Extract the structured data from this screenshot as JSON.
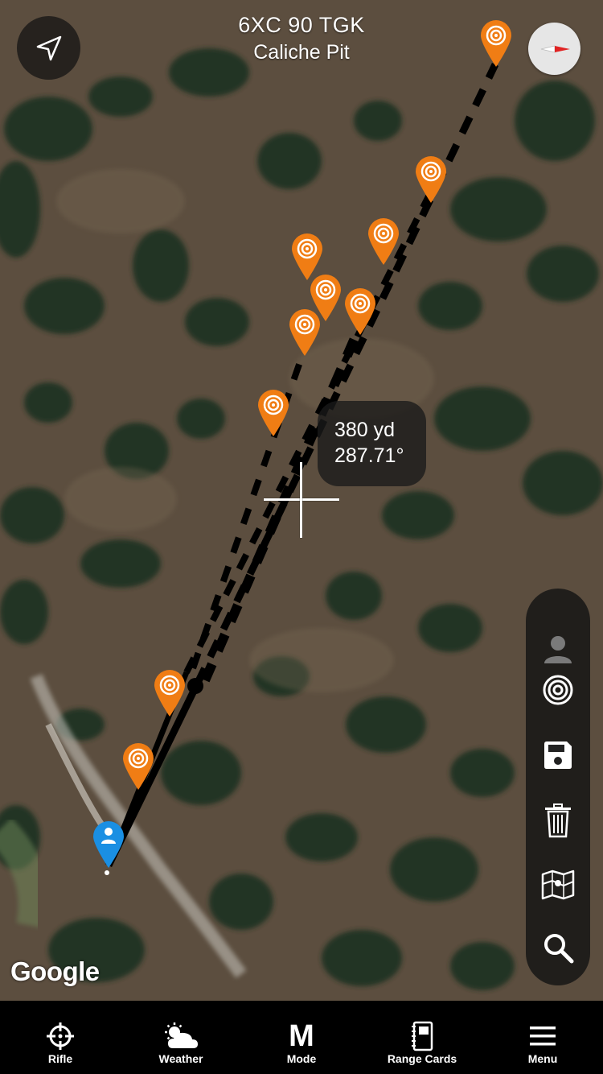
{
  "header": {
    "profile": "6XC 90 TGK",
    "location": "Caliche Pit"
  },
  "readout": {
    "distance": "380 yd",
    "bearing": "287.71°"
  },
  "attribution": "Google",
  "toolbar": {
    "items": [
      "person-icon",
      "target-icon",
      "save-icon",
      "trash-icon",
      "map-icon",
      "search-icon"
    ]
  },
  "tabs": [
    {
      "label": "Rifle",
      "icon": "crosshair-icon"
    },
    {
      "label": "Weather",
      "icon": "weather-icon"
    },
    {
      "label": "Mode",
      "icon": "mode-m-icon",
      "glyph": "M"
    },
    {
      "label": "Range Cards",
      "icon": "range-card-icon"
    },
    {
      "label": "Menu",
      "icon": "hamburger-icon"
    }
  ],
  "colors": {
    "target_pin": "#f07d14",
    "shooter_pin": "#1a8fe3",
    "tabbar": "#000000"
  }
}
